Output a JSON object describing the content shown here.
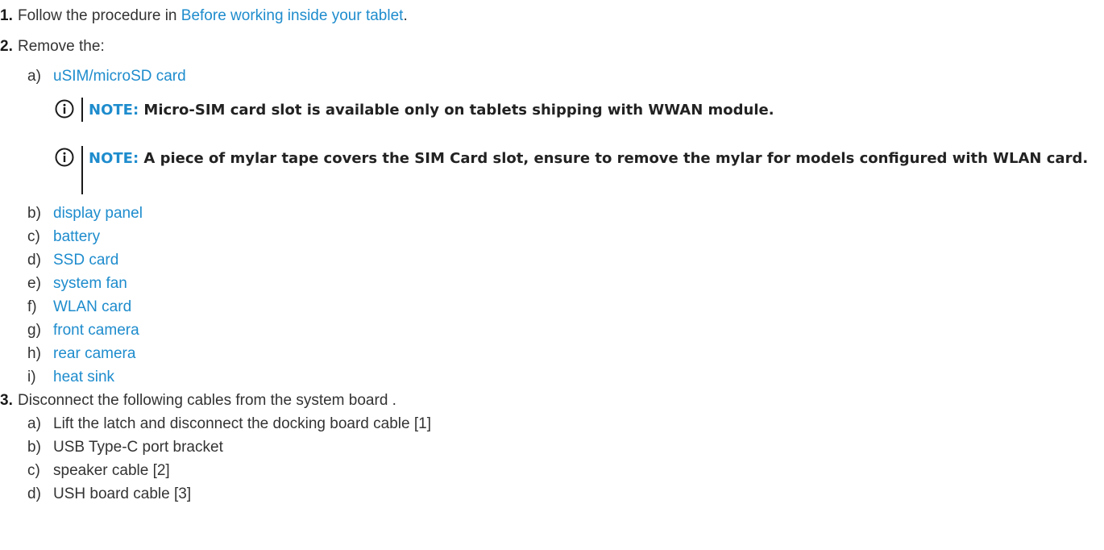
{
  "steps": [
    {
      "number": "1.",
      "text_before": "Follow the procedure in ",
      "link": "Before working inside your tablet",
      "text_after": "."
    },
    {
      "number": "2.",
      "text": "Remove the:",
      "substeps": [
        {
          "letter": "a)",
          "label": "uSIM/microSD card"
        },
        {
          "letter": "b)",
          "label": "display panel"
        },
        {
          "letter": "c)",
          "label": "battery"
        },
        {
          "letter": "d)",
          "label": "SSD card"
        },
        {
          "letter": "e)",
          "label": "system fan"
        },
        {
          "letter": "f)",
          "label": "WLAN card"
        },
        {
          "letter": "g)",
          "label": "front camera"
        },
        {
          "letter": "h)",
          "label": "rear camera"
        },
        {
          "letter": "i)",
          "label": "heat sink"
        }
      ],
      "notes": [
        {
          "label": "NOTE:",
          "text": "Micro-SIM card slot is available only on tablets shipping with WWAN module."
        },
        {
          "label": "NOTE:",
          "text": "A piece of mylar tape covers the SIM Card slot, ensure to remove the mylar for models configured with WLAN card."
        }
      ]
    },
    {
      "number": "3.",
      "text": "Disconnect the following cables from the system board .",
      "substeps": [
        {
          "letter": "a)",
          "label": "Lift the latch and disconnect the docking board cable [1]"
        },
        {
          "letter": "b)",
          "label": "USB Type-C port bracket"
        },
        {
          "letter": "c)",
          "label": "speaker cable [2]"
        },
        {
          "letter": "d)",
          "label": "USH board cable [3]"
        }
      ]
    }
  ],
  "colors": {
    "link": "#1e8ccd",
    "text": "#333333",
    "note_bar": "#1a1a1a"
  }
}
